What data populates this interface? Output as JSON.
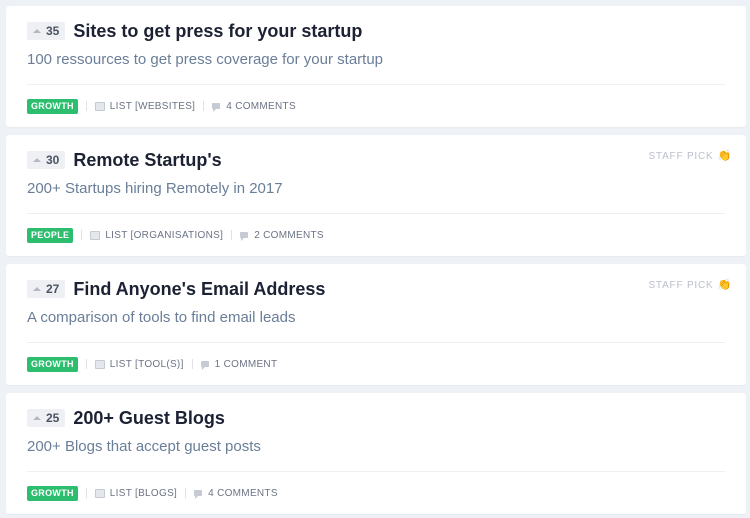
{
  "posts": [
    {
      "votes": "35",
      "title": "Sites to get press for your startup",
      "subtitle": "100 ressources to get press coverage for your startup",
      "tag": "GROWTH",
      "list_label": "LIST [WEBSITES]",
      "comments": "4 COMMENTS",
      "staff_pick": ""
    },
    {
      "votes": "30",
      "title": "Remote Startup's",
      "subtitle": "200+ Startups hiring Remotely in 2017",
      "tag": "PEOPLE",
      "list_label": "LIST [ORGANISATIONS]",
      "comments": "2 COMMENTS",
      "staff_pick": "STAFF PICK"
    },
    {
      "votes": "27",
      "title": "Find Anyone's Email Address",
      "subtitle": "A comparison of tools to find email leads",
      "tag": "GROWTH",
      "list_label": "LIST [TOOL(S)]",
      "comments": "1 COMMENT",
      "staff_pick": "STAFF PICK"
    },
    {
      "votes": "25",
      "title": "200+ Guest Blogs",
      "subtitle": "200+ Blogs that accept guest posts",
      "tag": "GROWTH",
      "list_label": "LIST [BLOGS]",
      "comments": "4 COMMENTS",
      "staff_pick": ""
    }
  ],
  "icons": {
    "upvote": "upvote-arrow-icon",
    "list": "list-icon",
    "comment": "comment-icon",
    "staff_pick": "clapping-hands-icon"
  },
  "colors": {
    "tag_green": "#2dbd6e",
    "title": "#1c2233",
    "subtitle": "#6a7e98",
    "background": "#eef1f5"
  }
}
